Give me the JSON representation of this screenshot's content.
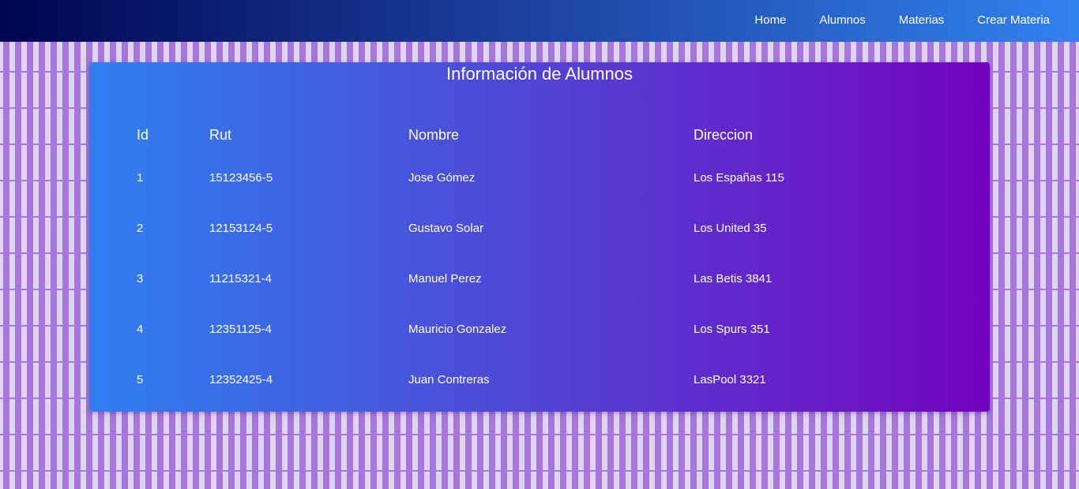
{
  "nav": {
    "items": [
      {
        "label": "Home"
      },
      {
        "label": "Alumnos"
      },
      {
        "label": "Materias"
      },
      {
        "label": "Crear Materia"
      }
    ]
  },
  "card": {
    "title": "Información de Alumnos",
    "table": {
      "headers": [
        "Id",
        "Rut",
        "Nombre",
        "Direccion"
      ],
      "rows": [
        [
          "1",
          "15123456-5",
          "Jose Gómez",
          "Los Españas 115"
        ],
        [
          "2",
          "12153124-5",
          "Gustavo Solar",
          "Los United 35"
        ],
        [
          "3",
          "11215321-4",
          "Manuel Perez",
          "Las Betis 3841"
        ],
        [
          "4",
          "12351125-4",
          "Mauricio Gonzalez",
          "Los Spurs 351"
        ],
        [
          "5",
          "12352425-4",
          "Juan Contreras",
          "LasPool 3321"
        ]
      ]
    }
  },
  "colors": {
    "nav_gradient_start": "#00054f",
    "nav_gradient_end": "#3282ef",
    "card_gradient_start": "#2f7ff0",
    "card_gradient_end": "#7302bd",
    "background": "#dcd6f2",
    "background_pattern": "#a775db",
    "text": "#ffffff"
  }
}
